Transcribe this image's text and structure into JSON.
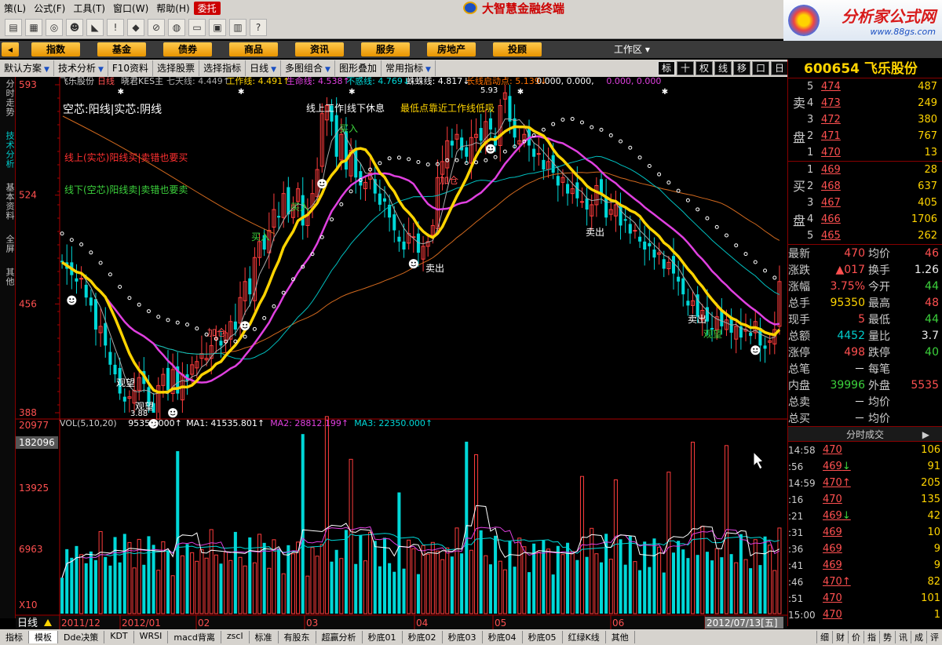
{
  "menubar": {
    "items": [
      "策(L)",
      "公式(F)",
      "工具(T)",
      "窗口(W)",
      "帮助(H)",
      "委托"
    ],
    "brand": "大智慧金融终端"
  },
  "corner": {
    "title": "分析家公式网",
    "url": "www.88gs.com"
  },
  "navbar": {
    "items": [
      "指数",
      "基金",
      "债券",
      "商品",
      "资讯",
      "服务",
      "房地产",
      "投顾"
    ],
    "workzone": "工作区"
  },
  "funcbar": {
    "items": [
      "默认方案",
      "技术分析",
      "F10资料",
      "选择股票",
      "选择指标",
      "日线",
      "多图组合",
      "图形叠加",
      "常用指标"
    ]
  },
  "rightbtns": [
    "标",
    "十",
    "权",
    "线",
    "移",
    "口",
    "日"
  ],
  "lefttabs": [
    "分时走势",
    "技术分析",
    "基本资料",
    "全屏",
    "其他"
  ],
  "chart": {
    "header": [
      "飞乐股份",
      "日线",
      "晓君KES主"
    ],
    "indicators": [
      {
        "label": "七天线: 4.449↑",
        "color": "#aaaaaa"
      },
      {
        "label": "工作线: 4.491↑",
        "color": "#ffd400"
      },
      {
        "label": "生命线: 4.538↑",
        "color": "#e040e0"
      },
      {
        "label": "不惑线: 4.769↓",
        "color": "#00d8d8"
      },
      {
        "label": "蛛蛛线: 4.817↓",
        "color": "#ffffff"
      },
      {
        "label": "长线启动点: 5.139↓",
        "color": "#ff7000"
      },
      {
        "label": "0.000, 0.000,",
        "color": "#ffffff"
      },
      {
        "label": "0.000, 0.000",
        "color": "#e040e0"
      }
    ],
    "price_axis": [
      "593",
      "524",
      "456",
      "388"
    ],
    "annotations": {
      "t1": "空芯:阳线|实芯:阴线",
      "t2": "线上工作|线下休息",
      "t3": "最低点靠近工作线低吸",
      "t4": "线上(实芯)阳线买|卖错也要买",
      "t5": "线下(空芯)阳线卖|卖错也要卖",
      "high": "5.93",
      "low": "3.88",
      "sell1": "卖出",
      "sell2": "卖出",
      "sell3": "卖出",
      "buy1": "买入",
      "buy2": "买入",
      "buy3": "买入",
      "add1": "加仓",
      "add2": "加仓",
      "watch1": "观望",
      "watch2": "观望",
      "watch3": "观望"
    },
    "vol_header": [
      {
        "label": "VOL(5,10,20)",
        "color": "#cccccc"
      },
      {
        "label": "95350.000↑",
        "color": "#ffffff"
      },
      {
        "label": "MA1: 41535.801↑",
        "color": "#ffffff"
      },
      {
        "label": "MA2: 28812.199↑",
        "color": "#e040e0"
      },
      {
        "label": "MA3: 22350.000↑",
        "color": "#00d8d8"
      }
    ],
    "vol_axis": [
      "20977",
      "182096",
      "13925",
      "6963",
      "X10"
    ],
    "date_axis": [
      "2011/12",
      "2012/01",
      "02",
      "03",
      "04",
      "05",
      "06",
      "2012/07/13[五]"
    ],
    "period": "日线"
  },
  "chart_data": [
    {
      "type": "candlestick",
      "title": "飞乐股份 日线",
      "x": [
        "2011/12",
        "2012/01",
        "02",
        "03",
        "04",
        "05",
        "06",
        "2012/07/13"
      ],
      "ylim": [
        3.88,
        5.93
      ],
      "series": [
        {
          "name": "工作线",
          "value": 4.491
        },
        {
          "name": "生命线",
          "value": 4.538
        },
        {
          "name": "七天线",
          "value": 4.449
        },
        {
          "name": "不惑线",
          "value": 4.769
        },
        {
          "name": "蛛蛛线",
          "value": 4.817
        },
        {
          "name": "长线启动点",
          "value": 5.139
        }
      ],
      "close": [
        4.82,
        4.78,
        4.74,
        4.7,
        4.72,
        4.6,
        4.55,
        4.4,
        4.42,
        4.3,
        4.18,
        4.12,
        4.0,
        3.95,
        3.98,
        4.02,
        4.1,
        4.06,
        3.92,
        3.88,
        4.05,
        4.12,
        4.02,
        4.15,
        4.0,
        4.12,
        4.08,
        4.18,
        4.2,
        4.25,
        4.22,
        4.3,
        4.35,
        4.3,
        4.38,
        4.45,
        4.4,
        4.6,
        4.7,
        4.62,
        4.85,
        4.95,
        4.9,
        5.02,
        5.15,
        5.1,
        5.25,
        5.12,
        5.18,
        5.28,
        5.05,
        5.12,
        5.25,
        5.4,
        5.75,
        5.8,
        5.7,
        5.48,
        5.62,
        5.4,
        5.52,
        5.35,
        5.3,
        5.32,
        5.38,
        5.25,
        5.18,
        5.2,
        5.1,
        5.02,
        4.95,
        4.9,
        5.0,
        4.98,
        4.88,
        4.92,
        4.95,
        5.05,
        5.35,
        5.45,
        5.58,
        5.55,
        5.62,
        5.52,
        5.48,
        5.6,
        5.62,
        5.58,
        5.7,
        5.65,
        5.55,
        5.8,
        5.88,
        5.7,
        5.6,
        5.58,
        5.62,
        5.55,
        5.48,
        5.5,
        5.4,
        5.45,
        5.38,
        5.3,
        5.35,
        5.25,
        5.28,
        5.22,
        5.2,
        5.15,
        5.18,
        5.3,
        5.25,
        5.1,
        5.15,
        5.18,
        5.05,
        5.08,
        5.0,
        5.02,
        4.95,
        4.9,
        4.92,
        4.85,
        4.88,
        4.78,
        4.82,
        4.75,
        4.7,
        4.62,
        4.55,
        4.58,
        4.48,
        4.52,
        4.45,
        4.4,
        4.48,
        4.42,
        4.46,
        4.38,
        4.42,
        4.35,
        4.4,
        4.36,
        4.45,
        4.3,
        4.28,
        4.33,
        4.4,
        4.7
      ]
    },
    {
      "type": "bar",
      "title": "VOL(5,10,20)",
      "series": [
        {
          "name": "MA1",
          "value": 41535.801
        },
        {
          "name": "MA2",
          "value": 28812.199
        },
        {
          "name": "MA3",
          "value": 22350.0
        }
      ],
      "last_volume": 95350,
      "ylim": [
        0,
        20977
      ]
    }
  ],
  "quote": {
    "code": "600654",
    "name": "飞乐股份",
    "sell_label": [
      "卖",
      "盘"
    ],
    "buy_label": [
      "买",
      "盘"
    ],
    "asks": [
      {
        "lvl": "5",
        "price": "474",
        "vol": "487"
      },
      {
        "lvl": "4",
        "price": "473",
        "vol": "249"
      },
      {
        "lvl": "3",
        "price": "472",
        "vol": "380"
      },
      {
        "lvl": "2",
        "price": "471",
        "vol": "767"
      },
      {
        "lvl": "1",
        "price": "470",
        "vol": "13"
      }
    ],
    "bids": [
      {
        "lvl": "1",
        "price": "469",
        "vol": "28"
      },
      {
        "lvl": "2",
        "price": "468",
        "vol": "637"
      },
      {
        "lvl": "3",
        "price": "467",
        "vol": "405"
      },
      {
        "lvl": "4",
        "price": "466",
        "vol": "1706"
      },
      {
        "lvl": "5",
        "price": "465",
        "vol": "262"
      }
    ],
    "stats": [
      [
        "最新",
        "470",
        "均价",
        "46"
      ],
      [
        "涨跌",
        "▲017",
        "换手",
        "1.26"
      ],
      [
        "涨幅",
        "3.75%",
        "今开",
        "44"
      ],
      [
        "总手",
        "95350",
        "最高",
        "48"
      ],
      [
        "现手",
        "5",
        "最低",
        "44"
      ],
      [
        "总额",
        "4452",
        "量比",
        "3.7"
      ],
      [
        "涨停",
        "498",
        "跌停",
        "40"
      ],
      [
        "总笔",
        "－",
        "每笔",
        ""
      ],
      [
        "内盘",
        "39996",
        "外盘",
        "5535"
      ],
      [
        "总卖",
        "－",
        "均价",
        ""
      ],
      [
        "总买",
        "－",
        "均价",
        ""
      ]
    ],
    "ticks_title": "分时成交",
    "ticks": [
      {
        "t": "14:58",
        "p": "470",
        "arrow": "",
        "v": "106"
      },
      {
        "t": ":56",
        "p": "469",
        "arrow": "↓",
        "v": "91"
      },
      {
        "t": "14:59",
        "p": "470",
        "arrow": "↑",
        "v": "205"
      },
      {
        "t": ":16",
        "p": "470",
        "arrow": "",
        "v": "135"
      },
      {
        "t": ":21",
        "p": "469",
        "arrow": "↓",
        "v": "42"
      },
      {
        "t": ":31",
        "p": "469",
        "arrow": "",
        "v": "10"
      },
      {
        "t": ":36",
        "p": "469",
        "arrow": "",
        "v": "9"
      },
      {
        "t": ":41",
        "p": "469",
        "arrow": "",
        "v": "9"
      },
      {
        "t": ":46",
        "p": "470",
        "arrow": "↑",
        "v": "82"
      },
      {
        "t": ":51",
        "p": "470",
        "arrow": "",
        "v": "101"
      },
      {
        "t": "15:00",
        "p": "470",
        "arrow": "",
        "v": "1"
      }
    ]
  },
  "bottomtabs": [
    "指标",
    "模板",
    "Dde决策",
    "KDT",
    "WRSI",
    "macd背离",
    "zscl",
    "标准",
    "有股东",
    "超赢分析",
    "秒底01",
    "秒底02",
    "秒底03",
    "秒底04",
    "秒底05",
    "红绿K线",
    "其他"
  ],
  "quotetabs": [
    "细",
    "财",
    "价",
    "指",
    "势",
    "讯",
    "成",
    "评"
  ],
  "colors": {
    "up": "#ff3c3c",
    "down": "#00d8d8",
    "work": "#ffd400",
    "life": "#e040e0"
  }
}
